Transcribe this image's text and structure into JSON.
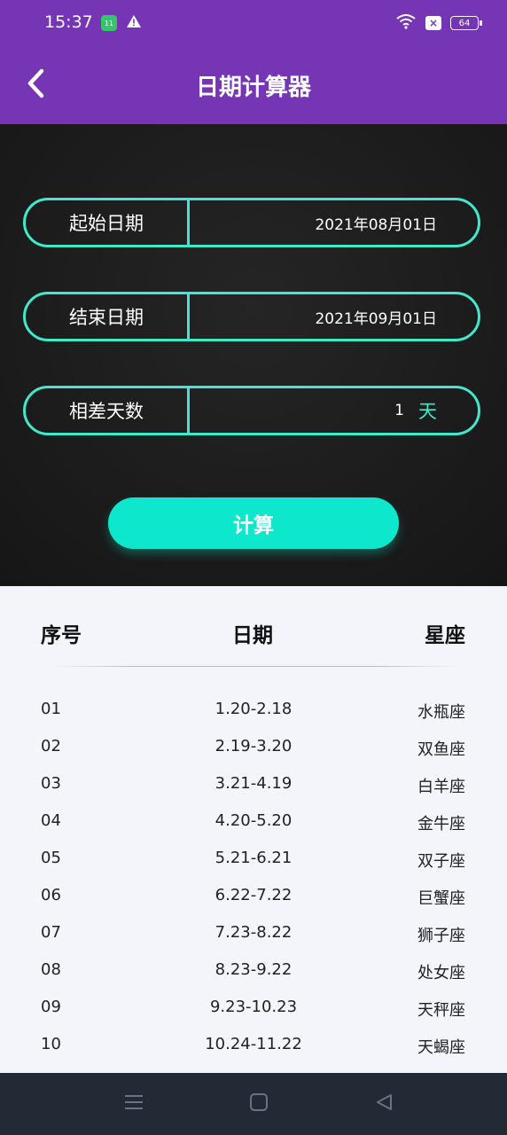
{
  "status": {
    "time": "15:37",
    "badge": "11",
    "battery": "64"
  },
  "header": {
    "title": "日期计算器"
  },
  "form": {
    "start_label": "起始日期",
    "start_value": "2021年08月01日",
    "end_label": "结束日期",
    "end_value": "2021年09月01日",
    "diff_label": "相差天数",
    "diff_value": "1",
    "diff_unit": "天",
    "calc_button": "计算"
  },
  "table": {
    "headers": [
      "序号",
      "日期",
      "星座"
    ],
    "rows": [
      {
        "num": "01",
        "date": "1.20-2.18",
        "sign": "水瓶座"
      },
      {
        "num": "02",
        "date": "2.19-3.20",
        "sign": "双鱼座"
      },
      {
        "num": "03",
        "date": "3.21-4.19",
        "sign": "白羊座"
      },
      {
        "num": "04",
        "date": "4.20-5.20",
        "sign": "金牛座"
      },
      {
        "num": "05",
        "date": "5.21-6.21",
        "sign": "双子座"
      },
      {
        "num": "06",
        "date": "6.22-7.22",
        "sign": "巨蟹座"
      },
      {
        "num": "07",
        "date": "7.23-8.22",
        "sign": "狮子座"
      },
      {
        "num": "08",
        "date": "8.23-9.22",
        "sign": "处女座"
      },
      {
        "num": "09",
        "date": "9.23-10.23",
        "sign": "天秤座"
      },
      {
        "num": "10",
        "date": "10.24-11.22",
        "sign": "天蝎座"
      }
    ]
  },
  "colors": {
    "header": "#7535b5",
    "accent": "#40e8cc",
    "button": "#0de8cd",
    "navbar": "#222a36"
  },
  "icons": [
    "back-arrow-icon",
    "wifi-icon",
    "warning-icon",
    "menu-icon",
    "home-icon",
    "back-triangle-icon"
  ]
}
